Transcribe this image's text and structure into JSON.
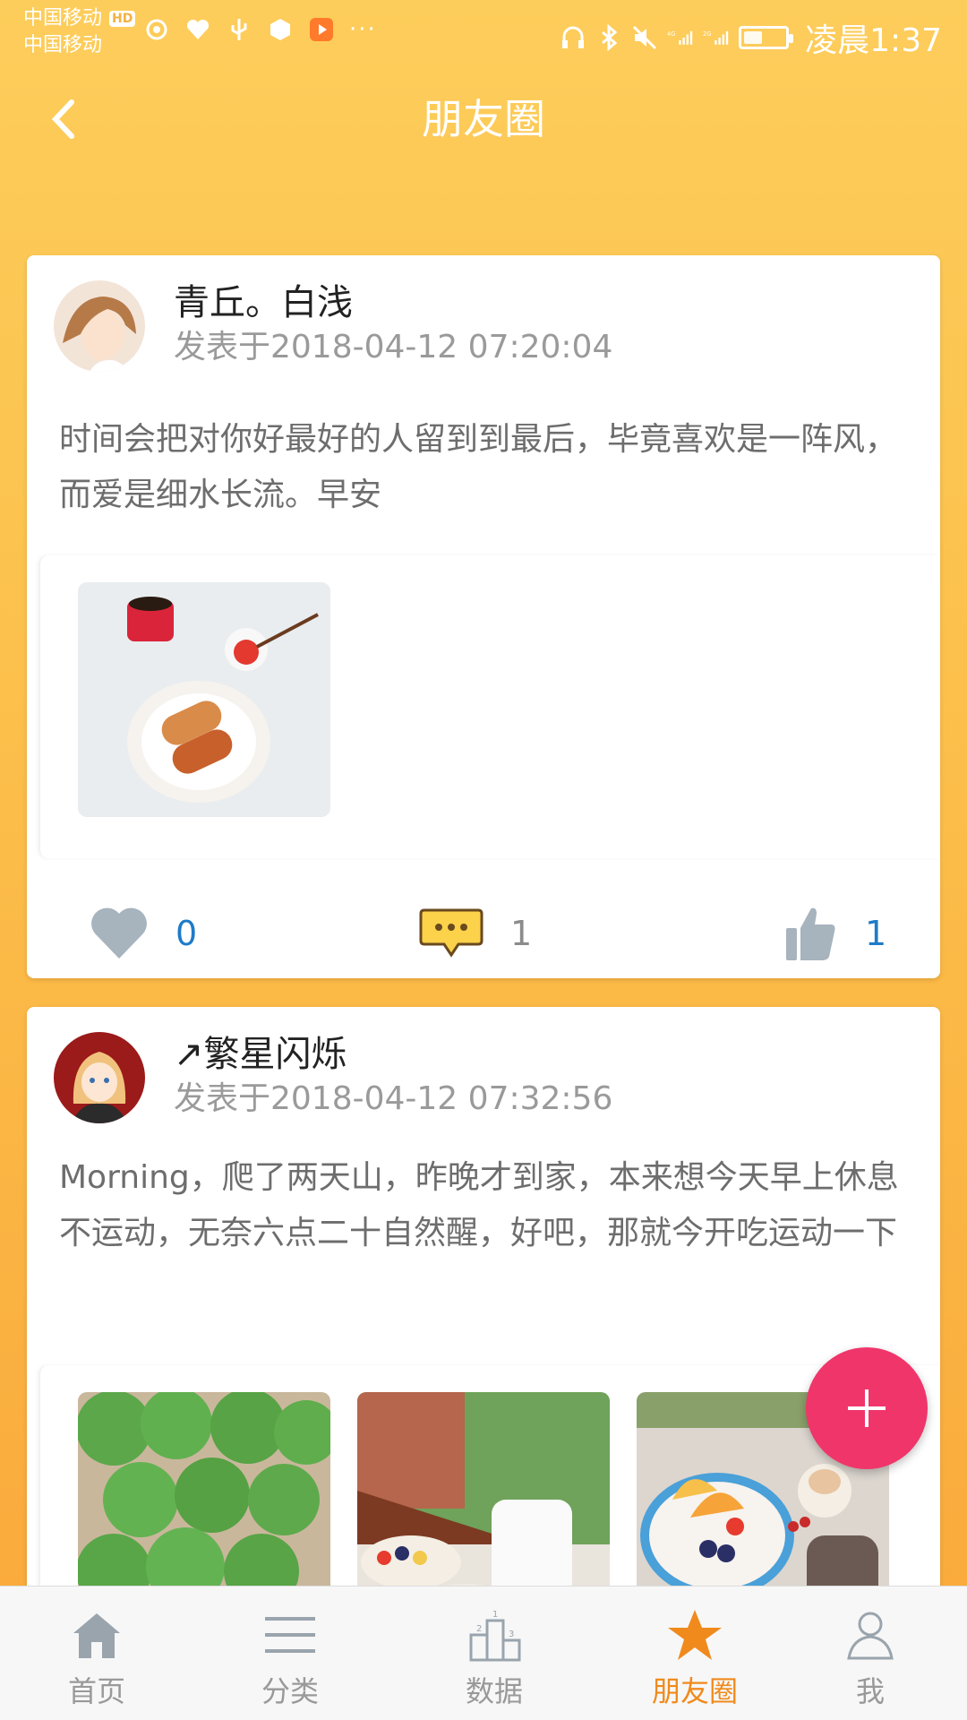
{
  "status_bar": {
    "carrier1": "中国移动",
    "carrier1_badge": "HD",
    "carrier2": "中国移动",
    "more": "···",
    "signal_4g": "4G",
    "signal_2g": "2G",
    "time": "凌晨1:37"
  },
  "header": {
    "title": "朋友圈"
  },
  "posts": [
    {
      "author": "青丘。白浅",
      "posted": "发表于2018-04-12 07:20:04",
      "content": "时间会把对你好最好的人留到到最后，毕竟喜欢是一阵风，而爱是细水长流。早安",
      "likes": "0",
      "comments": "1",
      "thumbs": "1"
    },
    {
      "author": "↗繁星闪烁",
      "posted": "发表于2018-04-12 07:32:56",
      "content": "Morning，爬了两天山，昨晚才到家，本来想今天早上休息不运动，无奈六点二十自然醒，好吧，那就今开吃运动一下"
    }
  ],
  "fab": {
    "label": "+"
  },
  "nav": {
    "items": [
      {
        "label": "首页",
        "icon": "home-icon"
      },
      {
        "label": "分类",
        "icon": "menu-icon"
      },
      {
        "label": "数据",
        "icon": "podium-icon"
      },
      {
        "label": "朋友圈",
        "icon": "star-icon",
        "active": true
      },
      {
        "label": "我",
        "icon": "user-icon"
      }
    ]
  },
  "colors": {
    "header_bg": "#fcc04b",
    "active_nav": "#f08a1c",
    "fab": "#f0356a",
    "count_blue": "#1e7bc9"
  }
}
